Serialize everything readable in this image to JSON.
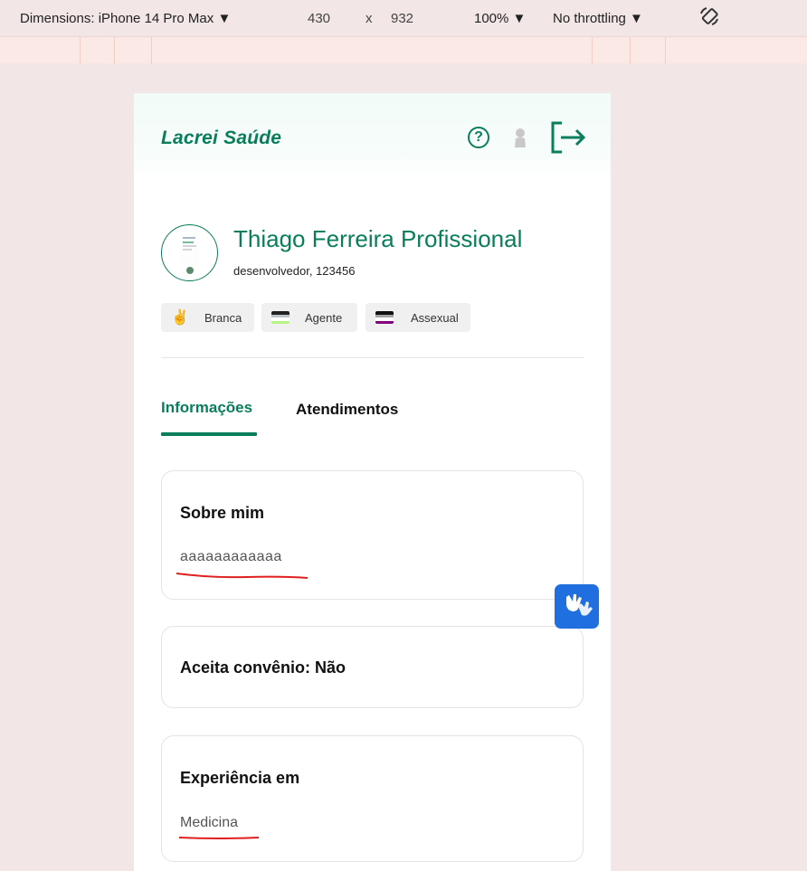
{
  "devtools": {
    "device_label": "Dimensions: iPhone 14 Pro Max ▼",
    "width": "430",
    "times": "x",
    "height": "932",
    "zoom": "100% ▼",
    "throttling": "No throttling ▼",
    "rotate_icon": "rotate-icon"
  },
  "app": {
    "brand": "Lacrei Saúde",
    "header_icons": [
      "help-icon",
      "user-icon",
      "logout-icon"
    ],
    "accent_color": "#0a7d5a"
  },
  "profile": {
    "name": "Thiago Ferreira Profissional",
    "subtitle": "desenvolvedor, 123456",
    "tags": [
      {
        "label": "Branca",
        "icon": "hand-icon"
      },
      {
        "label": "Agente",
        "icon": "agender-flag-icon"
      },
      {
        "label": "Assexual",
        "icon": "asexual-flag-icon"
      }
    ]
  },
  "tabs": [
    {
      "label": "Informações",
      "active": true
    },
    {
      "label": "Atendimentos",
      "active": false
    }
  ],
  "cards": {
    "about": {
      "title": "Sobre mim",
      "text": "aaaaaaaaaaaa"
    },
    "insurance": {
      "title": "Aceita convênio: Não"
    },
    "experience": {
      "title": "Experiência em",
      "text": "Medicina"
    }
  },
  "accessibility_button": "vlibras-hands-icon"
}
